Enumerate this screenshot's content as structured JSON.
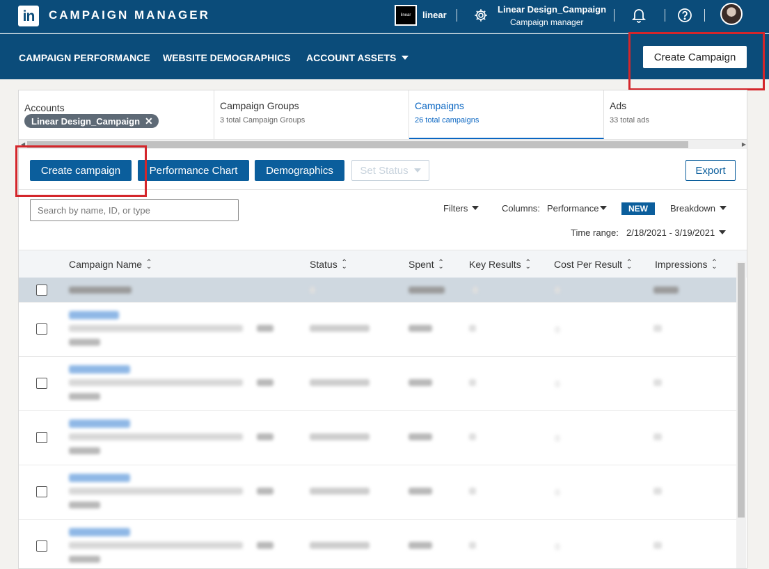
{
  "header": {
    "logo_text": "in",
    "brand": "CAMPAIGN MANAGER",
    "account_logo_text": "linear",
    "account_name": "linear",
    "campaign_title": "Linear Design_Campaign",
    "campaign_subtitle": "Campaign manager",
    "icons": [
      "gear-icon",
      "bell-icon",
      "help-icon",
      "avatar"
    ]
  },
  "nav": {
    "items": [
      "CAMPAIGN PERFORMANCE",
      "WEBSITE DEMOGRAPHICS",
      "ACCOUNT ASSETS"
    ],
    "create_button": "Create Campaign"
  },
  "tabs": {
    "accounts": {
      "label": "Accounts",
      "chip": "Linear Design_Campaign"
    },
    "campaign_groups": {
      "label": "Campaign Groups",
      "sub": "3 total Campaign Groups"
    },
    "campaigns": {
      "label": "Campaigns",
      "sub": "26 total campaigns"
    },
    "ads": {
      "label": "Ads",
      "sub": "33 total ads"
    }
  },
  "toolbar": {
    "create_campaign": "Create campaign",
    "performance_chart": "Performance Chart",
    "demographics": "Demographics",
    "set_status": "Set Status",
    "export": "Export"
  },
  "filters": {
    "search_placeholder": "Search by name, ID, or type",
    "filters_label": "Filters",
    "columns_label": "Columns:",
    "columns_value": "Performance",
    "new_badge": "NEW",
    "breakdown_label": "Breakdown",
    "time_range_label": "Time range:",
    "time_range_value": "2/18/2021 - 3/19/2021"
  },
  "table": {
    "columns": [
      "Campaign Name",
      "Status",
      "Spent",
      "Key Results",
      "Cost Per Result",
      "Impressions"
    ]
  },
  "colors": {
    "brand_navy": "#0b4c7a",
    "primary_button": "#0b5e9c",
    "highlight_red": "#d4262b"
  }
}
